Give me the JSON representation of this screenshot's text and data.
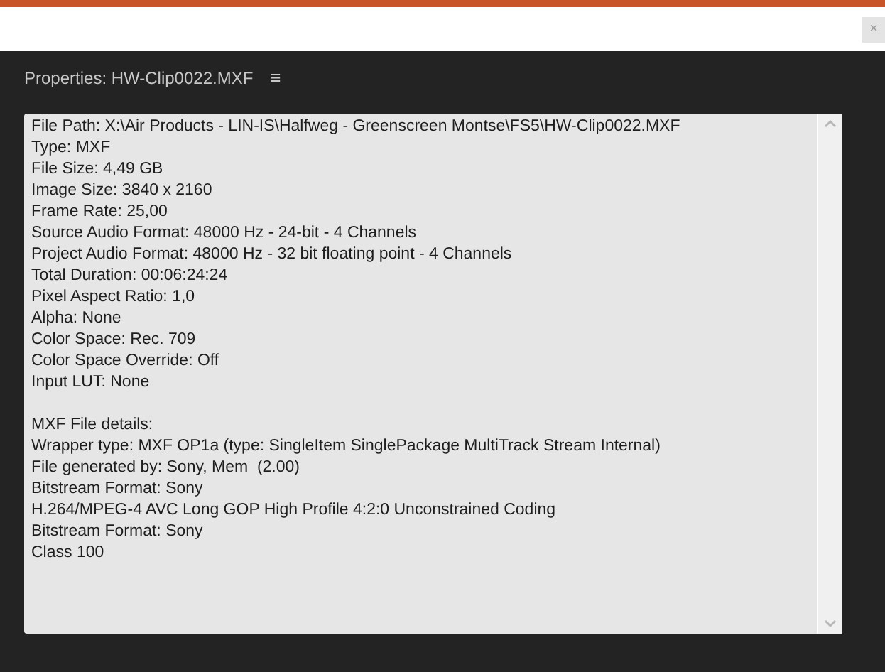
{
  "top_bar": {
    "close_button": "×"
  },
  "panel": {
    "title": "Properties: HW-Clip0022.MXF",
    "menu_icon": "≡"
  },
  "properties": {
    "general": [
      "File Path: X:\\Air Products - LIN-IS\\Halfweg - Greenscreen Montse\\FS5\\HW-Clip0022.MXF",
      "Type: MXF",
      "File Size: 4,49 GB",
      "Image Size: 3840 x 2160",
      "Frame Rate: 25,00",
      "Source Audio Format: 48000 Hz - 24-bit - 4 Channels",
      "Project Audio Format: 48000 Hz - 32 bit floating point - 4 Channels",
      "Total Duration: 00:06:24:24",
      "Pixel Aspect Ratio: 1,0",
      "Alpha: None",
      "Color Space: Rec. 709",
      "Color Space Override: Off",
      "Input LUT: None"
    ],
    "mxf_details": [
      "MXF File details:",
      "Wrapper type: MXF OP1a (type: SingleItem SinglePackage MultiTrack Stream Internal)",
      "File generated by: Sony, Mem  (2.00)",
      "Bitstream Format: Sony",
      "H.264/MPEG-4 AVC Long GOP High Profile 4:2:0 Unconstrained Coding",
      "Bitstream Format: Sony",
      "Class 100"
    ]
  }
}
